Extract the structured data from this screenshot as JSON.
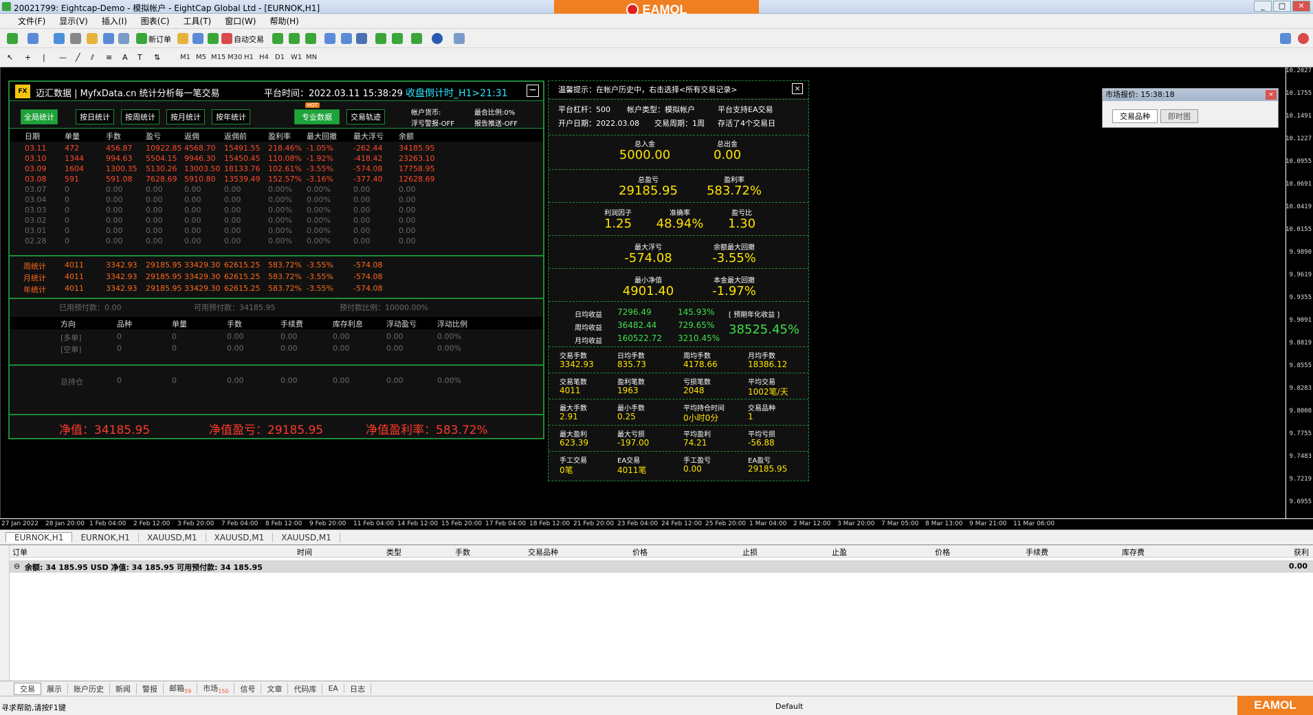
{
  "window": {
    "title": "20021799: Eightcap-Demo - 模拟帐户 - EightCap Global Ltd - [EURNOK,H1]",
    "brand": "EAMOL"
  },
  "menu": [
    "文件(F)",
    "显示(V)",
    "插入(I)",
    "图表(C)",
    "工具(T)",
    "窗口(W)",
    "帮助(H)"
  ],
  "toolbar": {
    "new_order": "新订单",
    "auto_trade": "自动交易",
    "timeframes": [
      "M1",
      "M5",
      "M15",
      "M30",
      "H1",
      "H4",
      "D1",
      "W1",
      "MN"
    ]
  },
  "panel": {
    "brand": "迈汇数据 | MyfxData.cn  统计分析每一笔交易",
    "logo": "FX",
    "time": "平台时间：2022.03.11 15:38:29",
    "countdown": "收盘倒计时_H1>21:31",
    "min": "−",
    "tabs": [
      "全局统计",
      "按日统计",
      "按周统计",
      "按月统计",
      "按年统计",
      "专业数据",
      "交易轨迹"
    ],
    "hot": "HOT",
    "side": {
      "currency": "帐户货币:",
      "float_alert": "浮亏警报-OFF",
      "margin_ratio": "最合比例:0%",
      "report_push": "报告推送-OFF"
    },
    "headers": [
      "日期",
      "单量",
      "手数",
      "盈亏",
      "返佣",
      "返佣前",
      "盈利率",
      "最大回撤",
      "最大浮亏",
      "余额"
    ],
    "rows": [
      [
        "03.11",
        "472",
        "456.87",
        "10922.85",
        "4568.70",
        "15491.55",
        "218.46%",
        "-1.05%",
        "-262.44",
        "34185.95"
      ],
      [
        "03.10",
        "1344",
        "994.63",
        "5504.15",
        "9946.30",
        "15450.45",
        "110.08%",
        "-1.92%",
        "-418.42",
        "23263.10"
      ],
      [
        "03.09",
        "1604",
        "1300.35",
        "5130.26",
        "13003.50",
        "18133.76",
        "102.61%",
        "-3.55%",
        "-574.08",
        "17758.95"
      ],
      [
        "03.08",
        "591",
        "591.08",
        "7628.69",
        "5910.80",
        "13539.49",
        "152.57%",
        "-3.16%",
        "-377.40",
        "12628.69"
      ],
      [
        "03.07",
        "0",
        "0.00",
        "0.00",
        "0.00",
        "0.00",
        "0.00%",
        "0.00%",
        "0.00",
        "0.00"
      ],
      [
        "03.04",
        "0",
        "0.00",
        "0.00",
        "0.00",
        "0.00",
        "0.00%",
        "0.00%",
        "0.00",
        "0.00"
      ],
      [
        "03.03",
        "0",
        "0.00",
        "0.00",
        "0.00",
        "0.00",
        "0.00%",
        "0.00%",
        "0.00",
        "0.00"
      ],
      [
        "03.02",
        "0",
        "0.00",
        "0.00",
        "0.00",
        "0.00",
        "0.00%",
        "0.00%",
        "0.00",
        "0.00"
      ],
      [
        "03.01",
        "0",
        "0.00",
        "0.00",
        "0.00",
        "0.00",
        "0.00%",
        "0.00%",
        "0.00",
        "0.00"
      ],
      [
        "02.28",
        "0",
        "0.00",
        "0.00",
        "0.00",
        "0.00",
        "0.00%",
        "0.00%",
        "0.00",
        "0.00"
      ]
    ],
    "summary": [
      [
        "周统计",
        "4011",
        "3342.93",
        "29185.95",
        "33429.30",
        "62615.25",
        "583.72%",
        "-3.55%",
        "-574.08"
      ],
      [
        "月统计",
        "4011",
        "3342.93",
        "29185.95",
        "33429.30",
        "62615.25",
        "583.72%",
        "-3.55%",
        "-574.08"
      ],
      [
        "年统计",
        "4011",
        "3342.93",
        "29185.95",
        "33429.30",
        "62615.25",
        "583.72%",
        "-3.55%",
        "-574.08"
      ]
    ],
    "margin": {
      "used": "已用预付款：0.00",
      "avail": "可用预付款：34185.95",
      "ratio": "预付款比例：10000.00%"
    },
    "pos_headers": [
      "方向",
      "品种",
      "单量",
      "手数",
      "手续费",
      "库存利息",
      "浮动盈亏",
      "浮动比例"
    ],
    "pos_rows": [
      [
        "[多单]",
        "0",
        "0",
        "0.00",
        "0.00",
        "0.00",
        "0.00",
        "0.00%"
      ],
      [
        "[空单]",
        "0",
        "0",
        "0.00",
        "0.00",
        "0.00",
        "0.00",
        "0.00%"
      ]
    ],
    "total_row": [
      "总持仓",
      "0",
      "0",
      "0.00",
      "0.00",
      "0.00",
      "0.00",
      "0.00%"
    ],
    "bottom": {
      "equity": "净值：34185.95",
      "pl": "净值盈亏：29185.95",
      "rate": "净值盈利率：583.72%"
    }
  },
  "stats": {
    "tip": "温馨提示：在帐户历史中，右击选择<所有交易记录>",
    "close": "×",
    "info1": [
      "平台杠杆：500",
      "帐户类型：模拟帐户",
      "平台支持EA交易"
    ],
    "info2": [
      "开户日期：2022.03.08",
      "交易周期：1周",
      "存活了4个交易日"
    ],
    "deposit_l": "总入金",
    "deposit": "5000.00",
    "withdraw_l": "总出金",
    "withdraw": "0.00",
    "profit_l": "总盈亏",
    "profit": "29185.95",
    "rate_l": "盈利率",
    "rate": "583.72%",
    "pf_l": "利润因子",
    "pf": "1.25",
    "acc_l": "准确率",
    "acc": "48.94%",
    "ratio_l": "盈亏比",
    "ratio": "1.30",
    "maxfloat_l": "最大浮亏",
    "maxfloat": "-574.08",
    "baldd_l": "余额最大回撤",
    "baldd": "-3.55%",
    "mineq_l": "最小净值",
    "mineq": "4901.40",
    "capdd_l": "本金最大回撤",
    "capdd": "-1.97%",
    "income": [
      [
        "日均收益",
        "7296.49",
        "145.93%"
      ],
      [
        "周均收益",
        "36482.44",
        "729.65%"
      ],
      [
        "月均收益",
        "160522.72",
        "3210.45%"
      ]
    ],
    "annual_l": "[ 预期年化收益 ]",
    "annual": "38525.45%",
    "grid": [
      [
        [
          "交易手数",
          "3342.93"
        ],
        [
          "日均手数",
          "835.73"
        ],
        [
          "周均手数",
          "4178.66"
        ],
        [
          "月均手数",
          "18386.12"
        ]
      ],
      [
        [
          "交易笔数",
          "4011"
        ],
        [
          "盈利笔数",
          "1963"
        ],
        [
          "亏损笔数",
          "2048"
        ],
        [
          "平均交易",
          "1002笔/天"
        ]
      ],
      [
        [
          "最大手数",
          "2.91"
        ],
        [
          "最小手数",
          "0.25"
        ],
        [
          "平均持仓时间",
          "0小时0分"
        ],
        [
          "交易品种",
          "1"
        ]
      ],
      [
        [
          "最大盈利",
          "623.39"
        ],
        [
          "最大亏损",
          "-197.00"
        ],
        [
          "平均盈利",
          "74.21"
        ],
        [
          "平均亏损",
          "-56.88"
        ]
      ],
      [
        [
          "手工交易",
          "0笔"
        ],
        [
          "EA交易",
          "4011笔"
        ],
        [
          "手工盈亏",
          "0.00"
        ],
        [
          "EA盈亏",
          "29185.95"
        ]
      ]
    ]
  },
  "market_watch": {
    "title": "市场报价: 15:38:18",
    "tabs": [
      "交易品种",
      "即时图"
    ],
    "close": "×"
  },
  "price_scale": [
    "10.2027",
    "10.1755",
    "10.1491",
    "10.1227",
    "10.0955",
    "10.0691",
    "10.0419",
    "10.0155",
    "9.9890",
    "9.9619",
    "9.9355",
    "9.9091",
    "9.8819",
    "9.8555",
    "9.8283",
    "9.8008",
    "9.7755",
    "9.7483",
    "9.7219",
    "9.6955"
  ],
  "time_scale": [
    "27 Jan 2022",
    "28 Jan 20:00",
    "1 Feb 04:00",
    "2 Feb 12:00",
    "3 Feb 20:00",
    "7 Feb 04:00",
    "8 Feb 12:00",
    "9 Feb 20:00",
    "11 Feb 04:00",
    "14 Feb 12:00",
    "15 Feb 20:00",
    "17 Feb 04:00",
    "18 Feb 12:00",
    "21 Feb 20:00",
    "23 Feb 04:00",
    "24 Feb 12:00",
    "25 Feb 20:00",
    "1 Mar 04:00",
    "2 Mar 12:00",
    "3 Mar 20:00",
    "7 Mar 05:00",
    "8 Mar 13:00",
    "9 Mar 21:00",
    "11 Mar 06:00"
  ],
  "chart_tabs": [
    "EURNOK,H1",
    "EURNOK,H1",
    "XAUUSD,M1",
    "XAUUSD,M1",
    "XAUUSD,M1"
  ],
  "terminal": {
    "headers": [
      "订单",
      "时间",
      "类型",
      "手数",
      "交易品种",
      "价格",
      "止损",
      "止盈",
      "价格",
      "手续费",
      "库存费",
      "获利"
    ],
    "balance_row": "余额: 34 185.95 USD  净值: 34 185.95  可用预付款: 34 185.95",
    "profit": "0.00"
  },
  "bottom_tabs": [
    "交易",
    "展示",
    "账户历史",
    "新闻",
    "警报",
    "邮箱",
    "市场",
    "信号",
    "文章",
    "代码库",
    "EA",
    "日志"
  ],
  "badges": {
    "mail": "59",
    "market": "150"
  },
  "status": {
    "help": "寻求帮助,请按F1键",
    "profile": "Default"
  }
}
